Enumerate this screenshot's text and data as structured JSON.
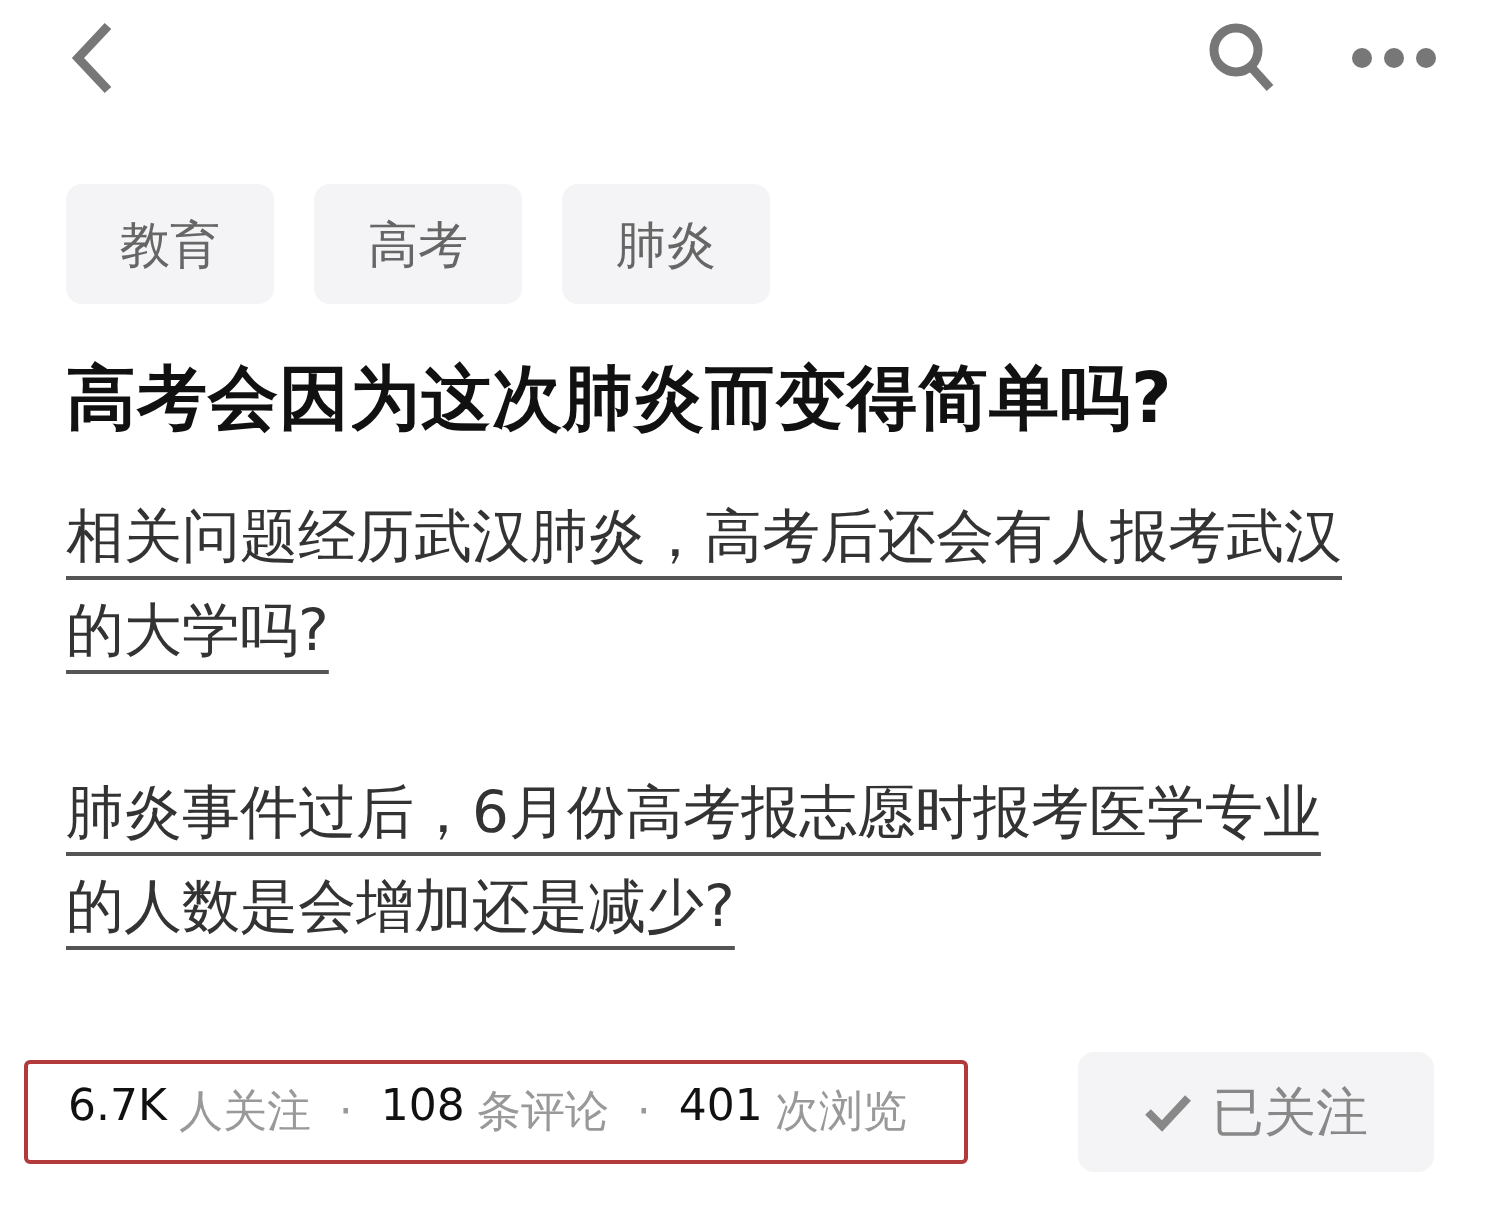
{
  "tags": [
    {
      "label": "教育"
    },
    {
      "label": "高考"
    },
    {
      "label": "肺炎"
    }
  ],
  "title": "高考会因为这次肺炎而变得简单吗?",
  "related_questions": [
    "相关问题经历武汉肺炎，高考后还会有人报考武汉的大学吗?",
    "肺炎事件过后，6月份高考报志愿时报考医学专业的人数是会增加还是减少?"
  ],
  "stats": [
    {
      "count": "6.7K",
      "suffix": "人关注"
    },
    {
      "count": "108",
      "suffix": "条评论"
    },
    {
      "count": "401",
      "suffix": "次浏览"
    }
  ],
  "stats_separator": "·",
  "stats_highlighted": true,
  "follow_button": {
    "label": "已关注",
    "followed": true
  }
}
